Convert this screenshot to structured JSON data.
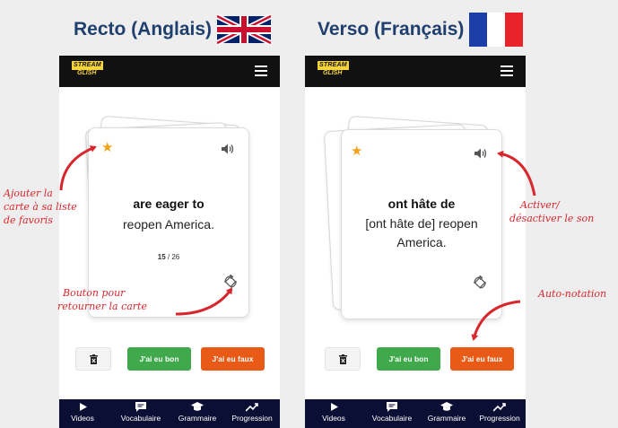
{
  "titles": {
    "left": "Recto (Anglais)",
    "right": "Verso (Français)"
  },
  "logo": {
    "line1": "STREAM",
    "line2": "GLISH"
  },
  "front_card": {
    "term": "are eager to",
    "text": "reopen America.",
    "counter_current": "15",
    "counter_total": " / 26"
  },
  "back_card": {
    "term": "ont hâte de",
    "text_line1": "[ont hâte de] reopen",
    "text_line2": "America."
  },
  "buttons": {
    "good": "J'ai eu bon",
    "bad": "J'ai eu faux"
  },
  "nav": {
    "videos": "Videos",
    "vocabulaire": "Vocabulaire",
    "grammaire": "Grammaire",
    "progression": "Progression"
  },
  "annotations": {
    "favoris_l1": "Ajouter la",
    "favoris_l2": "carte à sa liste",
    "favoris_l3": "de favoris",
    "retourner_l1": "Bouton pour",
    "retourner_l2": "retourner la  carte",
    "son_l1": "Activer/",
    "son_l2": "désactiver le son",
    "auto": "Auto-notation"
  },
  "colors": {
    "title": "#1f3f6e",
    "annotation": "#d8262d",
    "star": "#f2a21b",
    "good_button": "#3fa94b",
    "bad_button": "#ea5a17",
    "header": "#111111",
    "nav": "#0b0f33",
    "logo": "#f5d33a"
  },
  "icons": [
    "uk-flag-icon",
    "france-flag-icon",
    "menu-icon",
    "star-icon",
    "sound-icon",
    "flip-icon",
    "trash-icon",
    "play-icon",
    "vocabulary-icon",
    "graduation-cap-icon",
    "trend-icon"
  ]
}
